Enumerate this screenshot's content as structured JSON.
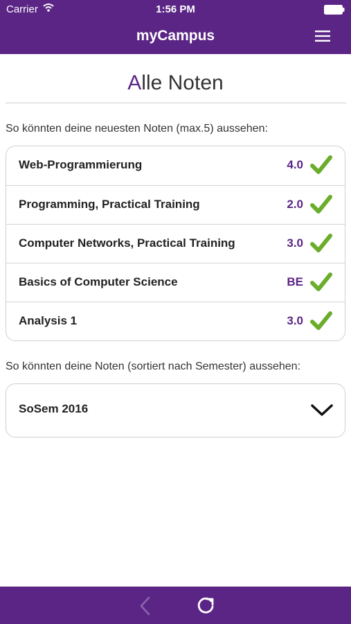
{
  "status_bar": {
    "carrier": "Carrier",
    "time": "1:56 PM"
  },
  "nav": {
    "title": "myCampus"
  },
  "page": {
    "title_first_letter": "A",
    "title_rest": "lle Noten"
  },
  "recent": {
    "label": "So könnten deine neuesten Noten (max.5) aussehen:",
    "items": [
      {
        "course": "Web-Programmierung",
        "grade": "4.0"
      },
      {
        "course": "Programming, Practical Training",
        "grade": "2.0"
      },
      {
        "course": "Computer Networks, Practical Training",
        "grade": "3.0"
      },
      {
        "course": "Basics of Computer Science",
        "grade": "BE"
      },
      {
        "course": "Analysis 1",
        "grade": "3.0"
      }
    ]
  },
  "semesters": {
    "label": "So könnten deine Noten (sortiert nach Semester) aussehen:",
    "items": [
      {
        "label": "SoSem 2016"
      }
    ]
  },
  "colors": {
    "brand": "#5b2586",
    "check": "#6aad2b"
  },
  "icons": {
    "menu": "hamburger-menu-icon",
    "check": "checkmark-icon",
    "expand": "chevron-down-icon",
    "back": "chevron-left-icon",
    "reload": "reload-icon"
  }
}
